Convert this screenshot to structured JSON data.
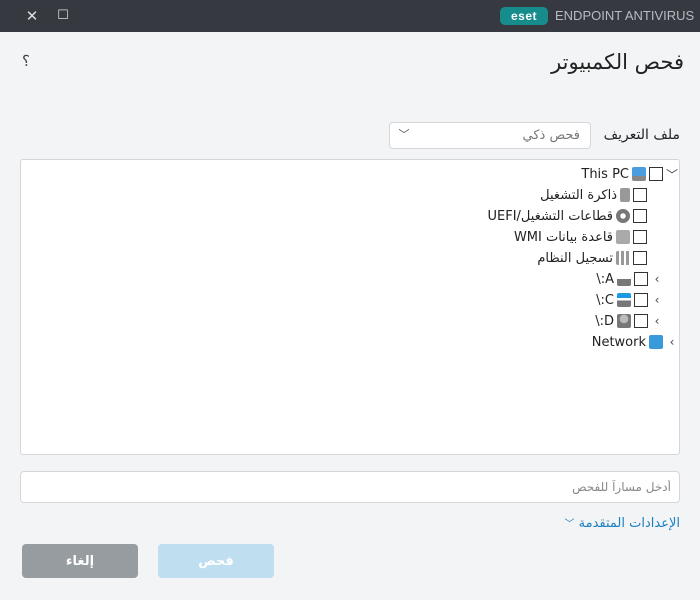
{
  "titlebar": {
    "logo_text": "eset",
    "product": "ENDPOINT ANTIVIRUS",
    "close": "✕",
    "maximize": "☐"
  },
  "page": {
    "title": "فحص الكمبيوتر",
    "help": "؟"
  },
  "profile": {
    "label": "ملف التعريف",
    "selected": "فحص ذكي"
  },
  "tree": {
    "root": {
      "label": "This PC",
      "icon": "computer-icon"
    },
    "children": [
      {
        "label": "ذاكرة التشغيل",
        "icon": "memory-icon"
      },
      {
        "label": "قطاعات التشغيل/UEFI",
        "icon": "disc-icon"
      },
      {
        "label": "قاعدة بيانات WMI",
        "icon": "wmi-database-icon"
      },
      {
        "label": "تسجيل النظام",
        "icon": "registry-icon"
      }
    ],
    "drives": [
      {
        "label": "A:\\",
        "icon": "floppy-drive-icon"
      },
      {
        "label": "C:\\",
        "icon": "system-drive-icon"
      },
      {
        "label": "D:\\",
        "icon": "cd-drive-icon"
      }
    ],
    "network": {
      "label": "Network",
      "icon": "network-icon"
    }
  },
  "path_input": {
    "placeholder": "أدخل مساراً للفحص",
    "value": ""
  },
  "advanced": {
    "label": "الإعدادات المتقدمة"
  },
  "buttons": {
    "scan": "فحص",
    "cancel": "إلغاء"
  },
  "colors": {
    "titlebar": "#363a40",
    "brand": "#178c8c",
    "scan_button": "#bfdff0",
    "cancel_button": "#979ca1",
    "link": "#1a7fbf"
  }
}
